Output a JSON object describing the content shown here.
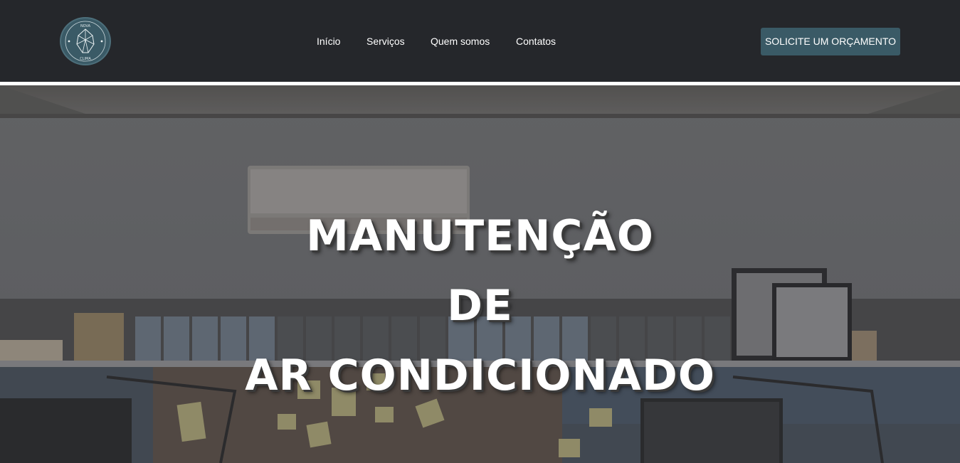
{
  "brand": {
    "logo_text_top": "NOVA",
    "logo_text_bottom": "CLIMA",
    "logo_color": "#3a5a66"
  },
  "nav": {
    "items": [
      {
        "label": "Início"
      },
      {
        "label": "Serviços"
      },
      {
        "label": "Quem somos"
      },
      {
        "label": "Contatos"
      }
    ],
    "cta_label": "SOLICITE UM ORÇAMENTO"
  },
  "hero": {
    "title_lines": [
      "MANUTENÇÃO",
      "DE",
      "AR CONDICIONADO"
    ]
  },
  "colors": {
    "navbar_bg": "#25272b",
    "accent": "#3a5a66",
    "text": "#ffffff"
  }
}
